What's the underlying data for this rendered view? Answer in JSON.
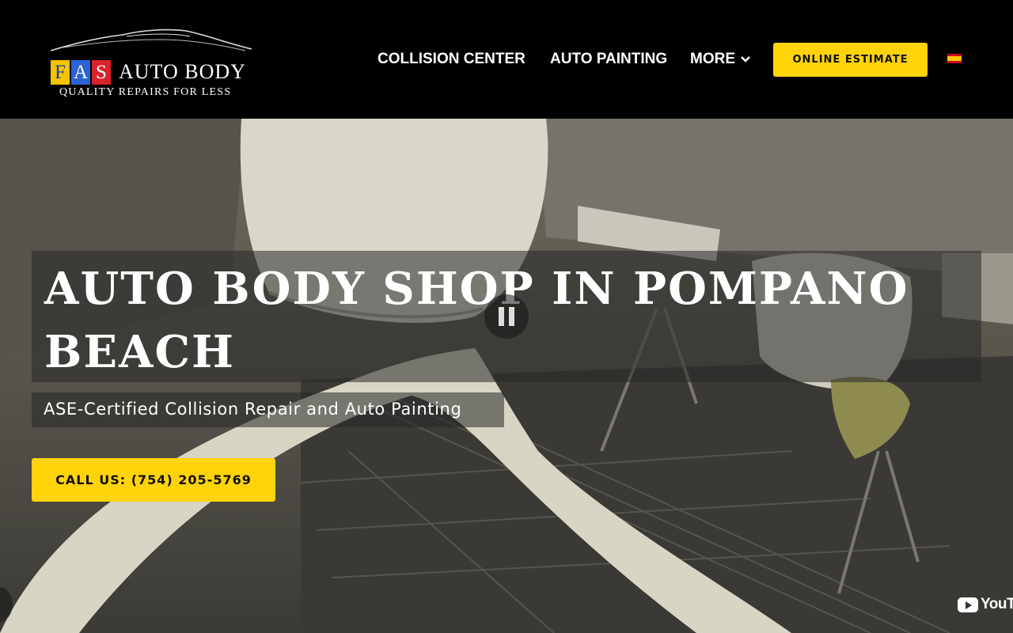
{
  "header": {
    "logo": {
      "letters": [
        "F",
        "A",
        "S"
      ],
      "name": "AUTO BODY",
      "tagline": "QUALITY REPAIRS FOR LESS"
    },
    "nav": {
      "collision": "COLLISION CENTER",
      "painting": "AUTO PAINTING",
      "more": "MORE",
      "estimate": "ONLINE ESTIMATE"
    },
    "language_flag": "es-flag-icon"
  },
  "hero": {
    "title": "AUTO BODY SHOP IN POMPANO BEACH",
    "subtitle": "ASE-Certified Collision Repair and Auto Painting",
    "call_button": "CALL US: (754) 205-5769",
    "video_brand": "YouTube",
    "video_brand_visible": "YouTu"
  },
  "colors": {
    "accent": "#ffd30a",
    "header_bg": "#000000"
  }
}
